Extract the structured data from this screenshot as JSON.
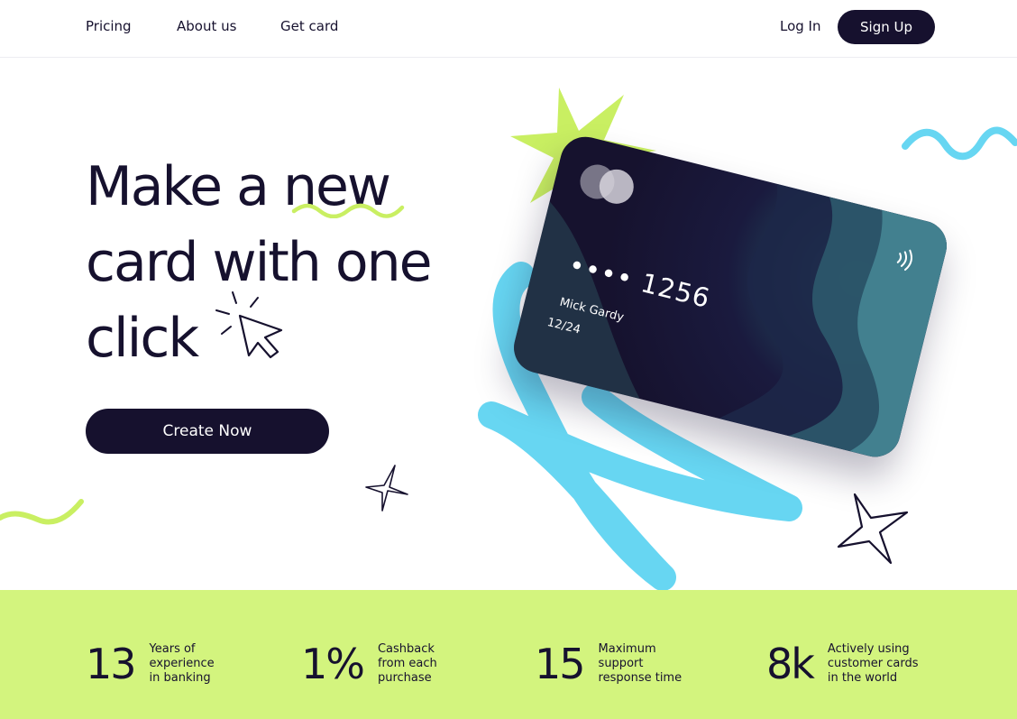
{
  "nav": {
    "items": [
      {
        "label": "Pricing"
      },
      {
        "label": "About us"
      },
      {
        "label": "Get card"
      }
    ],
    "login_label": "Log In",
    "signup_label": "Sign Up"
  },
  "hero": {
    "title_lines": [
      "Make a new",
      "card with one",
      "click"
    ],
    "cta_label": "Create Now"
  },
  "card": {
    "number": "•••• 1256",
    "holder": "Mick Gardy",
    "expiry": "12/24"
  },
  "stats": [
    {
      "value": "13",
      "description": "Years of\nexperience\nin banking"
    },
    {
      "value": "1%",
      "description": "Cashback\nfrom each\npurchase"
    },
    {
      "value": "15",
      "description": "Maximum\nsupport\nresponse time"
    },
    {
      "value": "8k",
      "description": "Actively using\ncustomer cards\nin the world"
    }
  ],
  "colors": {
    "dark": "#16112e",
    "lime": "#d3f47e",
    "lime_accent": "#c9ef62",
    "cyan": "#67d6f2"
  },
  "icons": [
    "cursor-click-icon",
    "sparkle-star-icon",
    "contactless-icon",
    "card-brand-logo-icon"
  ]
}
